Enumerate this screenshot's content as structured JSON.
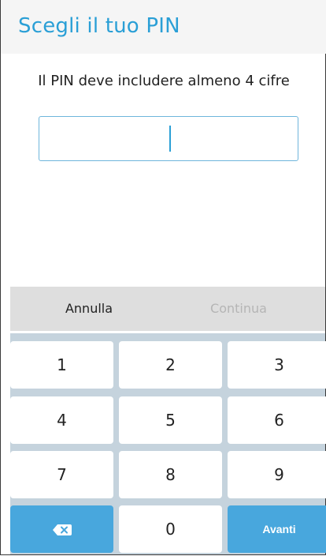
{
  "header": {
    "title": "Scegli il tuo PIN"
  },
  "instruction": "Il PIN deve includere almeno 4 cifre",
  "pin_input": {
    "value": ""
  },
  "actions": {
    "cancel_label": "Annulla",
    "continue_label": "Continua"
  },
  "keypad": {
    "keys": [
      "1",
      "2",
      "3",
      "4",
      "5",
      "6",
      "7",
      "8",
      "9"
    ],
    "zero": "0",
    "next_label": "Avanti",
    "backspace_icon": "backspace-icon"
  },
  "colors": {
    "accent": "#2a9fd6",
    "key_blue": "#48a7dd",
    "keypad_bg": "#c5d3dd",
    "action_bar_bg": "#dedede",
    "disabled_text": "#b5b5b5"
  }
}
